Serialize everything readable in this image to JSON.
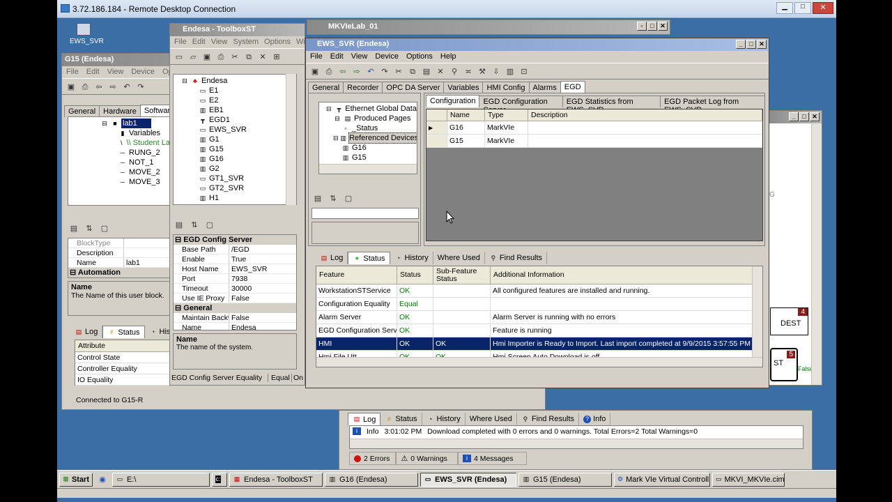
{
  "rdp": {
    "title": "3.72.186.184 - Remote Desktop Connection"
  },
  "desktop": {
    "ews_icon_label": "EWS_SVR"
  },
  "mkvie": {
    "title": "MKVIeLab_01"
  },
  "g15": {
    "title": "G15 (Endesa)",
    "menu": [
      "File",
      "Edit",
      "View",
      "Device",
      "Options"
    ],
    "tabs": [
      "General",
      "Hardware",
      "Software"
    ],
    "tree": [
      {
        "label": "lab1",
        "icon": "block-icon",
        "selected": true
      },
      {
        "label": "Variables",
        "icon": "variables-icon"
      },
      {
        "label": "\\\\ Student La",
        "icon": "comment-icon"
      },
      {
        "label": "RUNG_2",
        "icon": "rung-icon"
      },
      {
        "label": "NOT_1",
        "icon": "rung-icon"
      },
      {
        "label": "MOVE_2",
        "icon": "rung-icon"
      },
      {
        "label": "MOVE_3",
        "icon": "rung-icon"
      }
    ],
    "props": [
      {
        "k": "BlockType",
        "v": ""
      },
      {
        "k": "Description",
        "v": ""
      },
      {
        "k": "Name",
        "v": "lab1"
      }
    ],
    "props_cat2": "Automation",
    "help_title": "Name",
    "help_text": "The Name of this user block.",
    "bottom_tabs": [
      "Log",
      "Status",
      "His"
    ],
    "attr_header": "Attribute",
    "attrs": [
      "Control State",
      "Controller Equality",
      "IO Equality"
    ],
    "status": "Connected to G15-R"
  },
  "toolbox": {
    "title": "Endesa - ToolboxST",
    "menu": [
      "File",
      "Edit",
      "View",
      "System",
      "Options",
      "Wind"
    ],
    "tree_root": "Endesa",
    "tree": [
      {
        "label": "E1",
        "icon": "device-icon"
      },
      {
        "label": "E2",
        "icon": "device-icon"
      },
      {
        "label": "EB1",
        "icon": "controller-icon"
      },
      {
        "label": "EGD1",
        "icon": "network-icon"
      },
      {
        "label": "EWS_SVR",
        "icon": "computer-icon"
      },
      {
        "label": "G1",
        "icon": "controller-icon"
      },
      {
        "label": "G15",
        "icon": "controller-icon"
      },
      {
        "label": "G16",
        "icon": "controller-icon"
      },
      {
        "label": "G2",
        "icon": "controller-icon"
      },
      {
        "label": "GT1_SVR",
        "icon": "computer-icon"
      },
      {
        "label": "GT2_SVR",
        "icon": "computer-icon"
      },
      {
        "label": "H1",
        "icon": "controller-icon"
      }
    ],
    "prop_cat1": "EGD Config Server",
    "props1": [
      {
        "k": "Base Path",
        "v": "/EGD"
      },
      {
        "k": "Enable",
        "v": "True"
      },
      {
        "k": "Host Name",
        "v": "EWS_SVR"
      },
      {
        "k": "Port",
        "v": "7938"
      },
      {
        "k": "Timeout",
        "v": "30000"
      },
      {
        "k": "Use IE Proxy",
        "v": "False"
      }
    ],
    "prop_cat2": "General",
    "props2": [
      {
        "k": "Maintain Backw",
        "v": "False"
      },
      {
        "k": "Name",
        "v": "Endesa"
      }
    ],
    "help_title": "Name",
    "help_text": "The name of the system.",
    "status_left": "EGD Config Server Equality",
    "status_mid": "Equal",
    "status_right": "On"
  },
  "ews": {
    "title": "EWS_SVR (Endesa)",
    "menu": [
      "File",
      "Edit",
      "View",
      "Device",
      "Options",
      "Help"
    ],
    "tabs": [
      "General",
      "Recorder",
      "OPC DA Server",
      "Variables",
      "HMI Config",
      "Alarms",
      "EGD"
    ],
    "tree": [
      {
        "label": "Ethernet Global Data",
        "icon": "network-icon",
        "indent": 1
      },
      {
        "label": "Produced Pages",
        "icon": "pages-icon",
        "indent": 2
      },
      {
        "label": "_Status",
        "icon": "page-icon",
        "indent": 3
      },
      {
        "label": "Referenced Devices",
        "icon": "devices-icon",
        "indent": 2,
        "selected": true
      },
      {
        "label": "G16",
        "icon": "controller-icon",
        "indent": 3
      },
      {
        "label": "G15",
        "icon": "controller-icon",
        "indent": 3
      }
    ],
    "sub_tabs": [
      "Configuration",
      "EGD Configuration Server",
      "EGD Statistics from EWS_SVR",
      "EGD Packet Log from EWS_SVR"
    ],
    "grid_headers": [
      "Name",
      "Type",
      "Description"
    ],
    "grid_rows": [
      {
        "name": "G16",
        "type": "MarkVIe",
        "desc": ""
      },
      {
        "name": "G15",
        "type": "MarkVIe",
        "desc": ""
      }
    ],
    "bottom_tabs": [
      "Log",
      "Status",
      "History",
      "Where Used",
      "Find Results"
    ],
    "status_headers": [
      "Feature",
      "Status",
      "Sub-Feature Status",
      "Additional Information"
    ],
    "status_rows": [
      {
        "feature": "WorkstationSTService",
        "status": "OK",
        "sub": "",
        "info": "All configured features are installed and running."
      },
      {
        "feature": "Configuration Equality",
        "status": "Equal",
        "sub": "",
        "info": ""
      },
      {
        "feature": "Alarm Server",
        "status": "OK",
        "sub": "",
        "info": "Alarm Server is running with no errors"
      },
      {
        "feature": "EGD Configuration Server",
        "status": "OK",
        "sub": "",
        "info": "Feature is running"
      },
      {
        "feature": "HMI",
        "status": "OK",
        "sub": "OK",
        "info": "Hmi Importer is Ready to Import. Last import completed at 9/9/2015 3:57:55 PM",
        "selected": true
      },
      {
        "feature": "Hmi File Utt",
        "status": "OK",
        "sub": "OK",
        "info": "Hmi Screen Auto Download is off"
      }
    ]
  },
  "right_panel": {
    "letter": "G",
    "dest_num": "4",
    "dest_label": "DEST",
    "box_num": "5",
    "box_label": "ST",
    "false_label": "False"
  },
  "logwin": {
    "tabs": [
      "Log",
      "Status",
      "History",
      "Where Used",
      "Find Results",
      "Info"
    ],
    "entry_type": "Info",
    "entry_time": "3:01:02 PM",
    "entry_msg": "Download completed with 0 errors and 0 warnings.  Total Errors=2  Total Warnings=0",
    "errors": "2 Errors",
    "warnings": "0 Warnings",
    "messages": "4 Messages"
  },
  "taskbar": {
    "start": "Start",
    "items": [
      "E:\\",
      "",
      "Endesa - ToolboxST",
      "G16 (Endesa)",
      "EWS_SVR (Endesa)",
      "G15 (Endesa)",
      "Mark VIe Virtual Controll...",
      "MKVI_MKVIe.cim"
    ]
  }
}
